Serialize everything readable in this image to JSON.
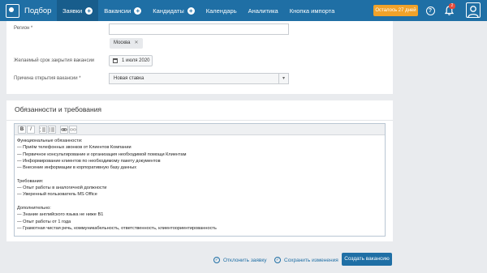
{
  "nav": {
    "brand": "Подбор",
    "items": [
      {
        "label": "Заявки",
        "active": true,
        "has_plus": true
      },
      {
        "label": "Вакансии",
        "active": false,
        "has_plus": true
      },
      {
        "label": "Кандидаты",
        "active": false,
        "has_plus": true
      },
      {
        "label": "Календарь",
        "active": false,
        "has_plus": false
      },
      {
        "label": "Аналитика",
        "active": false,
        "has_plus": false
      },
      {
        "label": "Кнопка импорта",
        "active": false,
        "has_plus": false
      }
    ],
    "trial_label": "Осталось 27 дней",
    "notification_count": "2",
    "icons": [
      "help-icon",
      "bell-icon",
      "user-icon"
    ]
  },
  "form": {
    "region_label": "Регион *",
    "region_value": "",
    "region_chip": "Москва",
    "deadline_label": "Желаемый срок закрытия вакансии",
    "deadline_value": "1 июля 2020",
    "reason_label": "Причина открытия вакансии *",
    "reason_value": "Новая ставка"
  },
  "duties": {
    "title": "Обязанности и требования",
    "toolbar": [
      "B",
      "I",
      "ordered-list",
      "bullet-list",
      "link",
      "unlink"
    ],
    "lines": [
      "Функциональные обязанности:",
      "— Приём телефонных звонков от Клиентов Компании",
      "— Первичное консультирование и организация необходимой помощи Клиентам",
      "— Информирование клиентов по необходимому пакету документов",
      "— Внесение информации в корпоративную базу данных",
      "",
      "Требования:",
      "— Опыт работы в аналогичной должности",
      "— Уверенный пользователь MS Office",
      "",
      "Дополнительно:",
      "— Знание английского языка не ниже В1",
      "— Опыт работы от 1 года",
      "— Грамотная чистая речь, коммуникабельность, ответственность, клиентоориентированность"
    ]
  },
  "footer": {
    "reject_label": "Отклонить заявку",
    "save_label": "Сохранить изменения",
    "create_label": "Создать вакансию"
  },
  "colors": {
    "nav_bg": "#1f6fa5",
    "trial_bg": "#f0a22a",
    "primary_button": "#1f6fa5",
    "page_bg": "#e9ebee"
  }
}
